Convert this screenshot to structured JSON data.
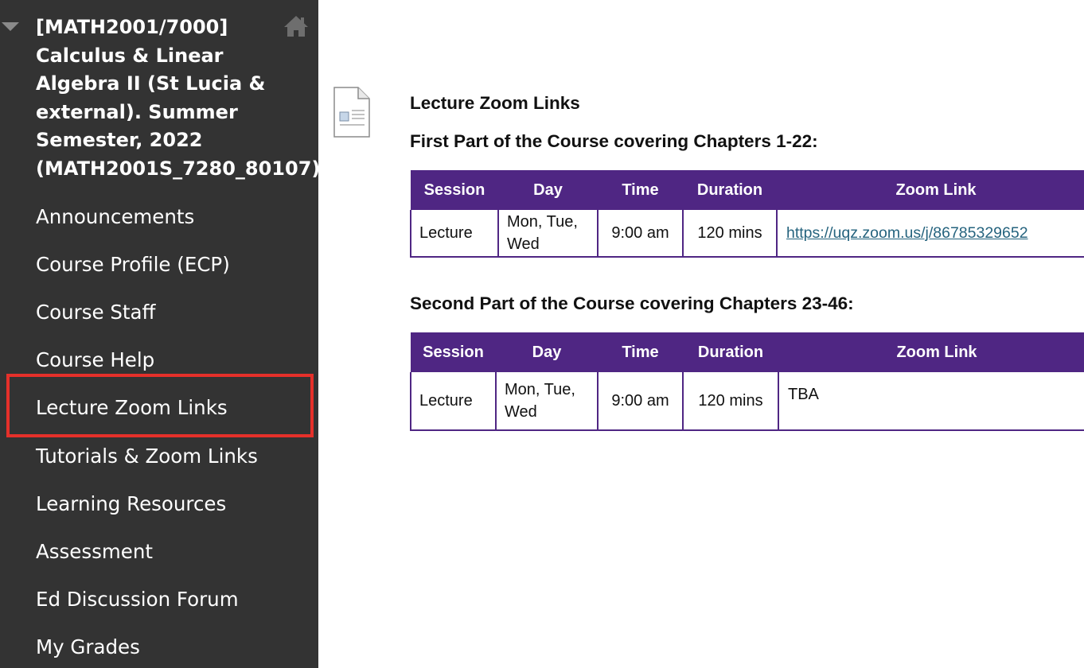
{
  "sidebar": {
    "course_title": "[MATH2001/7000]\nCalculus & Linear\nAlgebra II (St Lucia &\nexternal). Summer\nSemester, 2022\n(MATH2001S_7280_80107)",
    "items": [
      {
        "label": "Announcements"
      },
      {
        "label": "Course Profile (ECP)"
      },
      {
        "label": "Course Staff"
      },
      {
        "label": "Course Help"
      },
      {
        "label": "Lecture Zoom Links"
      },
      {
        "label": "Tutorials & Zoom Links"
      },
      {
        "label": "Learning Resources"
      },
      {
        "label": "Assessment"
      },
      {
        "label": "Ed Discussion Forum"
      },
      {
        "label": "My Grades"
      }
    ],
    "selected_index": 4
  },
  "content": {
    "title": "Lecture Zoom Links",
    "section1": {
      "heading": "First Part of the Course covering Chapters 1-22:",
      "headers": [
        "Session",
        "Day",
        "Time",
        "Duration",
        "Zoom Link"
      ],
      "row": {
        "session": "Lecture",
        "day_line1": "Mon, Tue,",
        "day_line2": "Wed",
        "time": "9:00 am",
        "duration": "120 mins",
        "zoom": "https://uqz.zoom.us/j/86785329652"
      }
    },
    "section2": {
      "heading": "Second Part of the Course covering Chapters 23-46:",
      "headers": [
        "Session",
        "Day",
        "Time",
        "Duration",
        "Zoom Link"
      ],
      "row": {
        "session": "Lecture",
        "day_line1": "Mon, Tue,",
        "day_line2": "Wed",
        "time": "9:00 am",
        "duration": "120 mins",
        "zoom": "TBA"
      }
    }
  },
  "colors": {
    "sidebar_bg": "#333333",
    "table_header_bg": "#4f2683",
    "highlight_border": "#e5302a",
    "link": "#25637e"
  },
  "icons": {
    "collapse": "caret-down-icon",
    "home": "home-icon",
    "content_item": "document-icon"
  }
}
